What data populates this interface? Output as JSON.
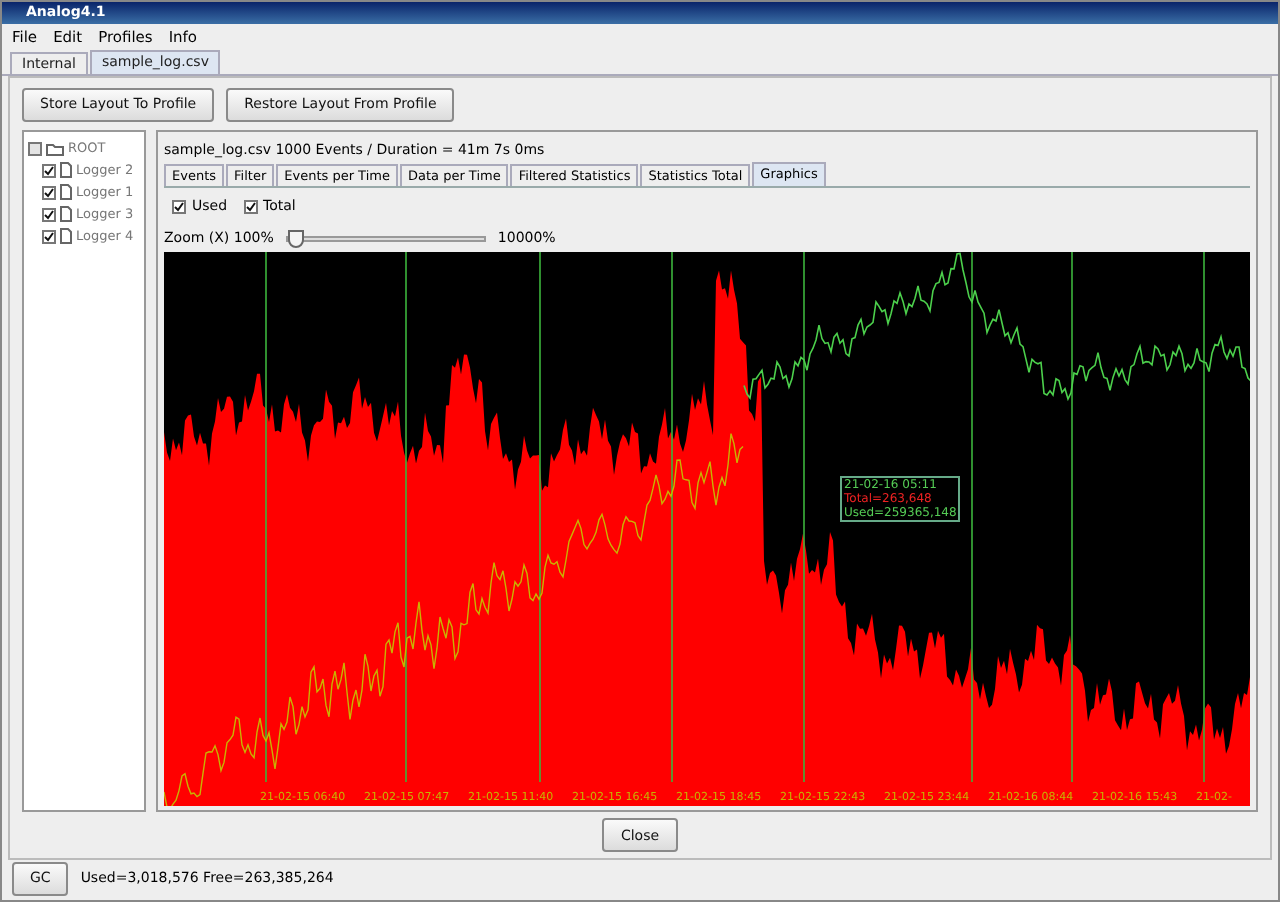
{
  "window": {
    "title": "Analog4.1"
  },
  "menu": [
    "File",
    "Edit",
    "Profiles",
    "Info"
  ],
  "file_tabs": [
    {
      "label": "Internal",
      "selected": false
    },
    {
      "label": "sample_log.csv",
      "selected": true
    }
  ],
  "toolbar": [
    "Store Layout To Profile",
    "Restore Layout From Profile"
  ],
  "tree": {
    "label": "ROOT",
    "checked": false,
    "children": [
      {
        "label": "Logger 2",
        "checked": true
      },
      {
        "label": "Logger 1",
        "checked": true
      },
      {
        "label": "Logger 3",
        "checked": true
      },
      {
        "label": "Logger 4",
        "checked": true
      }
    ]
  },
  "header": "sample_log.csv 1000 Events / Duration = 41m 7s 0ms",
  "view_tabs": [
    {
      "label": "Events",
      "selected": false
    },
    {
      "label": "Filter",
      "selected": false
    },
    {
      "label": "Events per Time",
      "selected": false
    },
    {
      "label": "Data per Time",
      "selected": false
    },
    {
      "label": "Filtered Statistics",
      "selected": false
    },
    {
      "label": "Statistics Total",
      "selected": false
    },
    {
      "label": "Graphics",
      "selected": true
    }
  ],
  "series_toggles": [
    {
      "label": "Used",
      "checked": true
    },
    {
      "label": "Total",
      "checked": true
    }
  ],
  "zoom": {
    "label": "Zoom (X) 100%",
    "level": 0,
    "max_label": "10000%"
  },
  "graph": {
    "time_labels": [
      "21-02-15 06:40",
      "21-02-15 07:47",
      "21-02-15 11:40",
      "21-02-15 16:45",
      "21-02-15 18:45",
      "21-02-15 22:43",
      "21-02-15 23:44",
      "21-02-16 08:44",
      "21-02-16 15:43",
      "21-02-"
    ],
    "tooltip": [
      "21-02-16 05:11",
      "Total=263,648",
      "Used=259365,148"
    ]
  },
  "close_button": "Close",
  "status": {
    "button": "GC",
    "text": "Used=3,018,576 Free=263,385,264"
  }
}
